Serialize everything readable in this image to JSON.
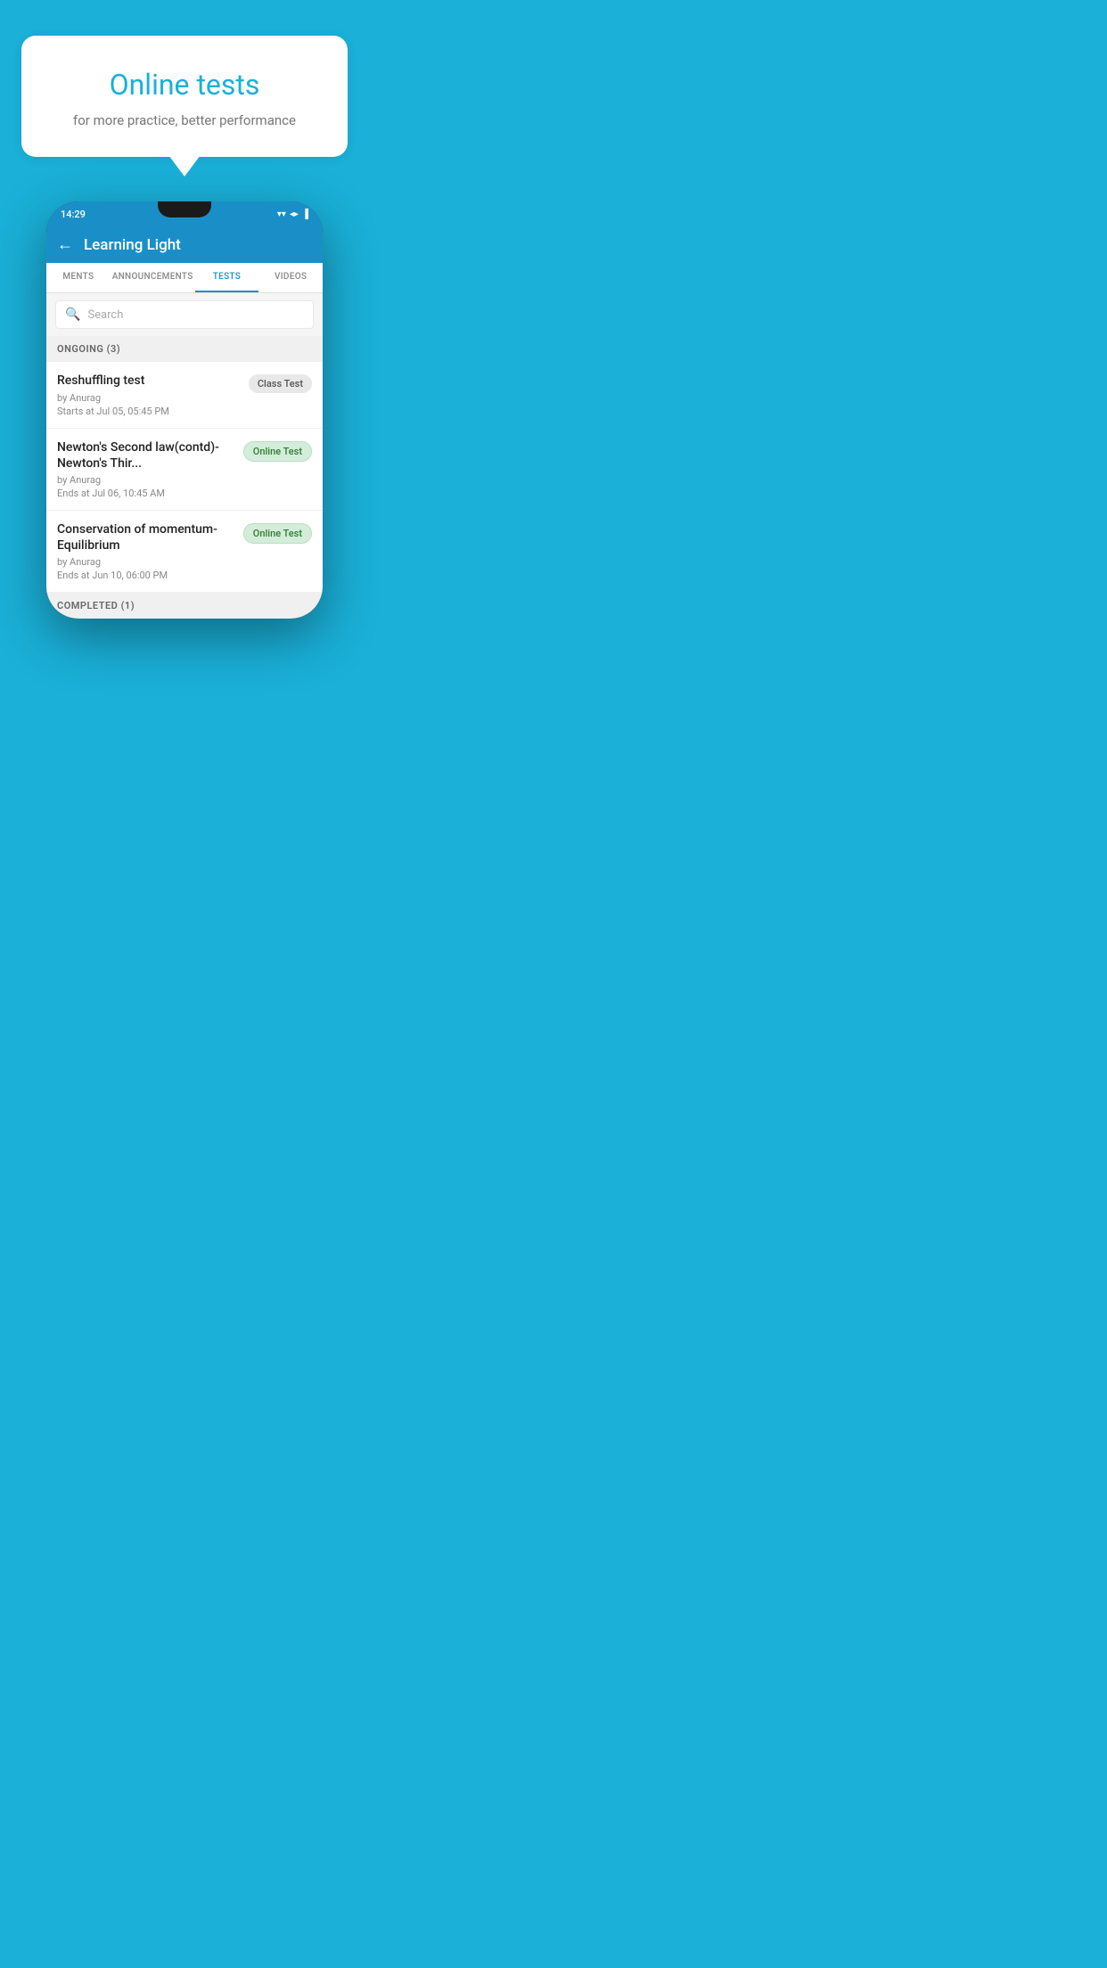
{
  "hero": {
    "bubble_title": "Online tests",
    "bubble_subtitle": "for more practice, better performance"
  },
  "phone": {
    "status_bar": {
      "time": "14:29",
      "wifi_icon": "▼",
      "signal_icon": "▲",
      "battery_icon": "▐"
    },
    "app_bar": {
      "back_label": "←",
      "title": "Learning Light"
    },
    "tabs": [
      {
        "label": "MENTS",
        "active": false
      },
      {
        "label": "ANNOUNCEMENTS",
        "active": false
      },
      {
        "label": "TESTS",
        "active": true
      },
      {
        "label": "VIDEOS",
        "active": false
      }
    ],
    "search": {
      "placeholder": "Search"
    },
    "section_ongoing": {
      "label": "ONGOING (3)"
    },
    "tests_ongoing": [
      {
        "name": "Reshuffling test",
        "by": "by Anurag",
        "date": "Starts at  Jul 05, 05:45 PM",
        "badge": "Class Test",
        "badge_type": "class"
      },
      {
        "name": "Newton's Second law(contd)-Newton's Thir...",
        "by": "by Anurag",
        "date": "Ends at  Jul 06, 10:45 AM",
        "badge": "Online Test",
        "badge_type": "online"
      },
      {
        "name": "Conservation of momentum-Equilibrium",
        "by": "by Anurag",
        "date": "Ends at  Jun 10, 06:00 PM",
        "badge": "Online Test",
        "badge_type": "online"
      }
    ],
    "section_completed": {
      "label": "COMPLETED (1)"
    }
  },
  "colors": {
    "background": "#1ab0d8",
    "app_bar": "#1a8fc7",
    "active_tab": "#1a8fc7",
    "badge_class_bg": "#e8e8e8",
    "badge_online_bg": "#d4edda",
    "badge_online_text": "#2e7d32"
  }
}
